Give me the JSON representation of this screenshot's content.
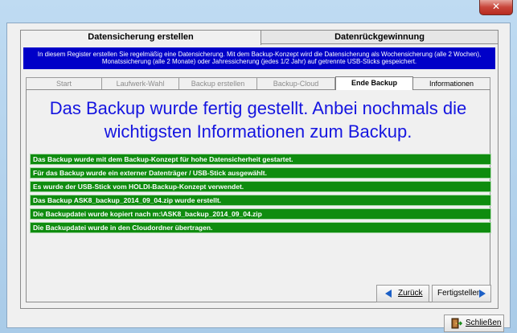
{
  "window": {
    "close_glyph": "✕"
  },
  "outer_tabs": [
    {
      "label": "Datensicherung erstellen",
      "active": true
    },
    {
      "label": "Datenrückgewinnung",
      "active": false
    }
  ],
  "info_banner": "In diesem Register erstellen Sie regelmäßig eine Datensicherung. Mit dem Backup-Konzept wird die Datensicherung als Wochensicherung (alle 2 Wochen), Monatssicherung (alle 2 Monate) oder Jahressicherung (jedes 1/2 Jahr) auf getrennte USB-Sticks gespeichert.",
  "inner_tabs": [
    {
      "label": "Start"
    },
    {
      "label": "Laufwerk-Wahl"
    },
    {
      "label": "Backup erstellen"
    },
    {
      "label": "Backup-Cloud"
    },
    {
      "label": "Ende Backup"
    },
    {
      "label": "Informationen"
    }
  ],
  "headline": "Das Backup wurde fertig gestellt. Anbei nochmals die wichtigsten Informationen zum Backup.",
  "messages": [
    "Das Backup wurde mit dem Backup-Konzept für hohe Datensicherheit gestartet.",
    "Für das Backup wurde ein externer Datenträger / USB-Stick ausgewählt.",
    "Es wurde der USB-Stick vom HOLDI-Backup-Konzept verwendet.",
    "Das Backup ASK8_backup_2014_09_04.zip wurde erstellt.",
    "Die Backupdatei wurde kopiert nach m:\\ASK8_backup_2014_09_04.zip",
    "Die Backupdatei wurde in den Cloudordner übertragen."
  ],
  "buttons": {
    "back": "Zurück",
    "finish": "Fertigstellen",
    "close": "Schließen"
  },
  "colors": {
    "banner": "#0000c8",
    "headline": "#1515e0",
    "message_bg": "#0f8c0f",
    "arrow": "#1b5fc6"
  }
}
